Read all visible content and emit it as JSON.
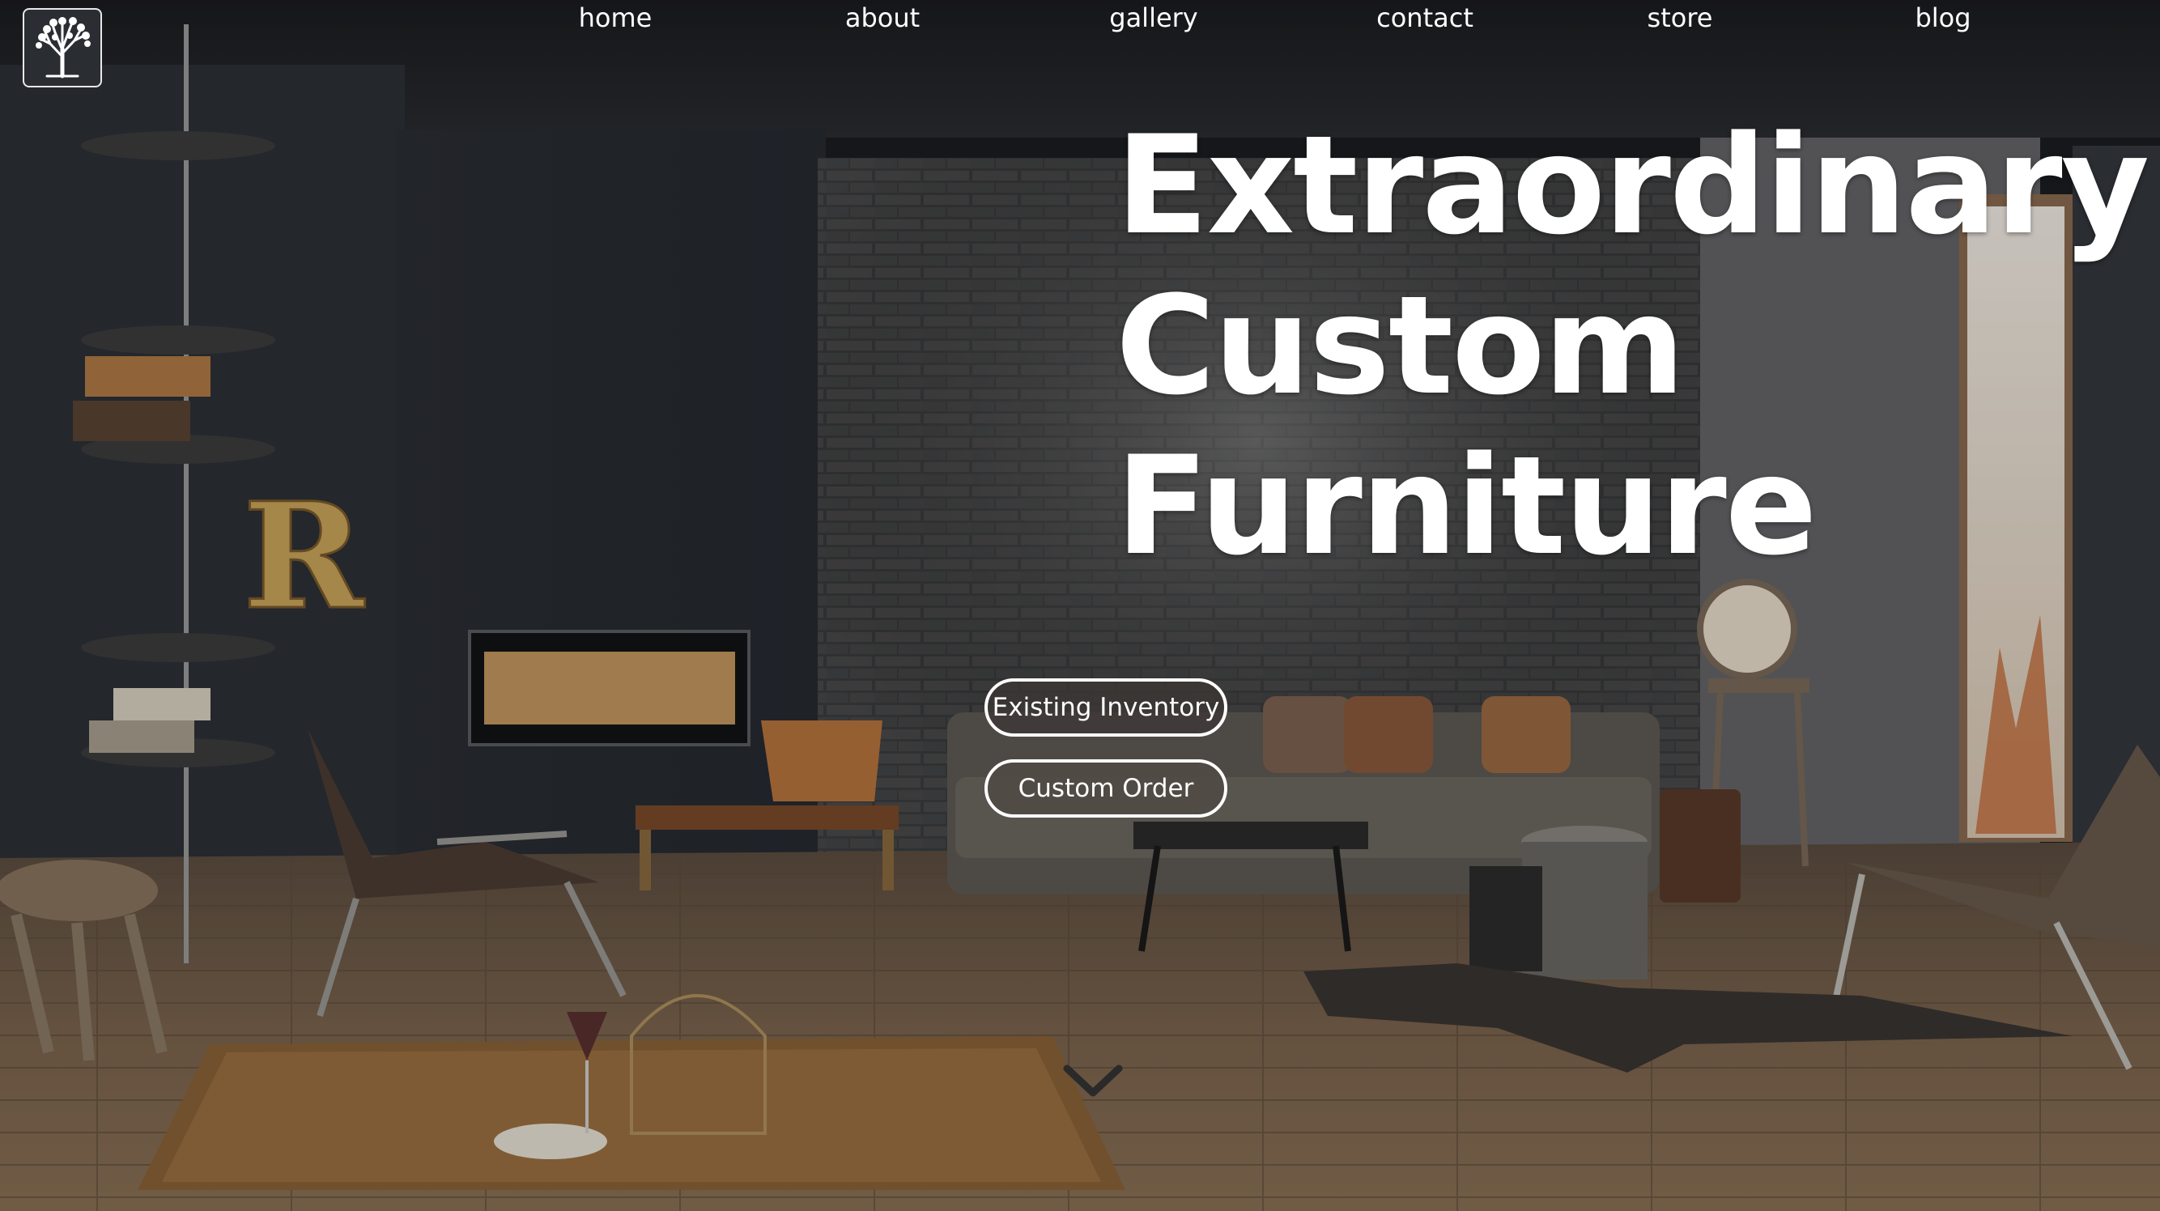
{
  "logo": {
    "icon": "tree-icon"
  },
  "nav": {
    "items": [
      {
        "label": "home"
      },
      {
        "label": "about"
      },
      {
        "label": "gallery"
      },
      {
        "label": "contact"
      },
      {
        "label": "store"
      },
      {
        "label": "blog"
      }
    ]
  },
  "hero": {
    "title_lines": [
      "Extraordinary",
      "Custom",
      "Furniture"
    ]
  },
  "buttons": {
    "existing_inventory": "Existing Inventory",
    "custom_order": "Custom Order"
  },
  "scroll": {
    "icon": "chevron-down-icon"
  },
  "colors": {
    "text": "#ffffff",
    "wall": "#2b2e33",
    "floor": "#6e5a47",
    "brick": "#3a3a3a"
  }
}
